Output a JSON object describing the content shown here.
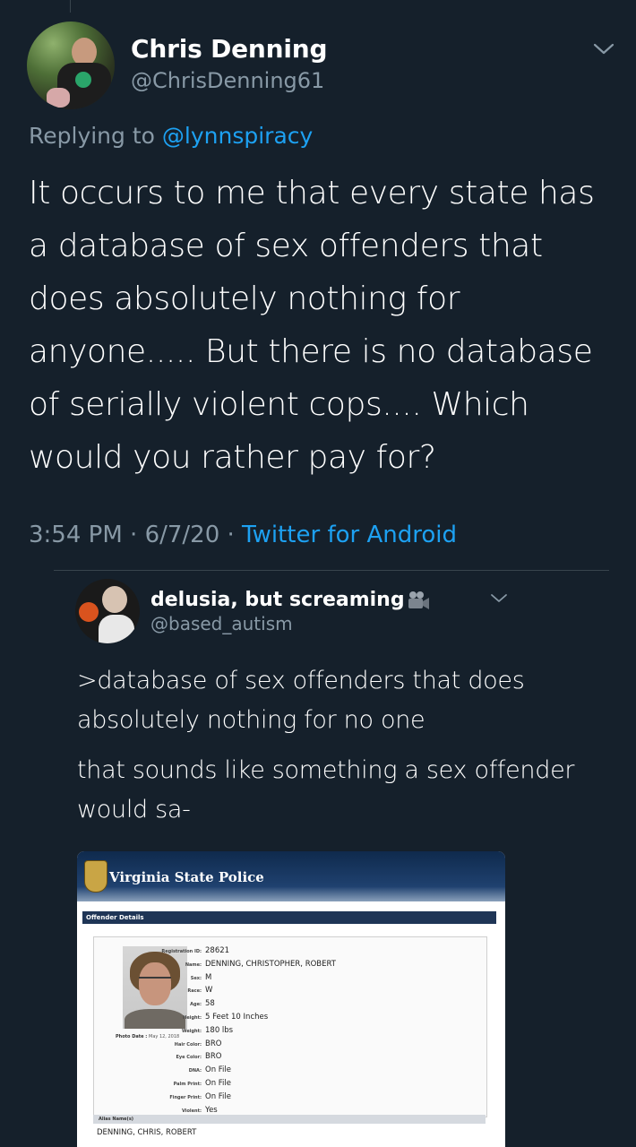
{
  "tweet": {
    "author_name": "Chris Denning",
    "author_handle": "@ChrisDenning61",
    "reply_prefix": "Replying to ",
    "reply_mention": "@lynnspiracy",
    "text": "It occurs to me that every state has a database of sex offenders that does absolutely nothing for anyone..... But there is no database of serially violent cops.... Which would you rather pay for?",
    "time": "3:54 PM",
    "separator": " · ",
    "date": "6/7/20",
    "source": "Twitter for Android",
    "menu_icon": "chevron-down-icon",
    "colors": {
      "background": "#15202b",
      "link": "#1da1f2",
      "secondary_text": "#8899a6"
    }
  },
  "quote": {
    "author_name": "delusia, but screaming",
    "name_emoji": "video-camera-icon",
    "author_handle": "@based_autism",
    "paragraph_1": ">database of sex offenders that does absolutely nothing for no one",
    "paragraph_2": "that sounds like something a sex offender would sa-",
    "menu_icon": "chevron-down-icon"
  },
  "embedded_image": {
    "site_title": "Virginia State Police",
    "section_title": "Offender Details",
    "photo_date_label": "Photo Date",
    "photo_date": "May 12, 2018",
    "fields": [
      {
        "label": "Registration ID",
        "value": "28621"
      },
      {
        "label": "Name",
        "value": "DENNING, CHRISTOPHER, ROBERT"
      },
      {
        "label": "Sex",
        "value": "M"
      },
      {
        "label": "Race",
        "value": "W"
      },
      {
        "label": "Age",
        "value": "58"
      },
      {
        "label": "Height",
        "value": "5 Feet 10 Inches"
      },
      {
        "label": "Weight",
        "value": "180 lbs"
      },
      {
        "label": "Hair Color",
        "value": "BRO"
      },
      {
        "label": "Eye Color",
        "value": "BRO"
      },
      {
        "label": "DNA",
        "value": "On File"
      },
      {
        "label": "Palm Print",
        "value": "On File"
      },
      {
        "label": "Finger Print",
        "value": "On File"
      },
      {
        "label": "Violent",
        "value": "Yes"
      }
    ],
    "alias_label": "Alias Name(s)",
    "alias_value": "DENNING, CHRIS, ROBERT"
  }
}
